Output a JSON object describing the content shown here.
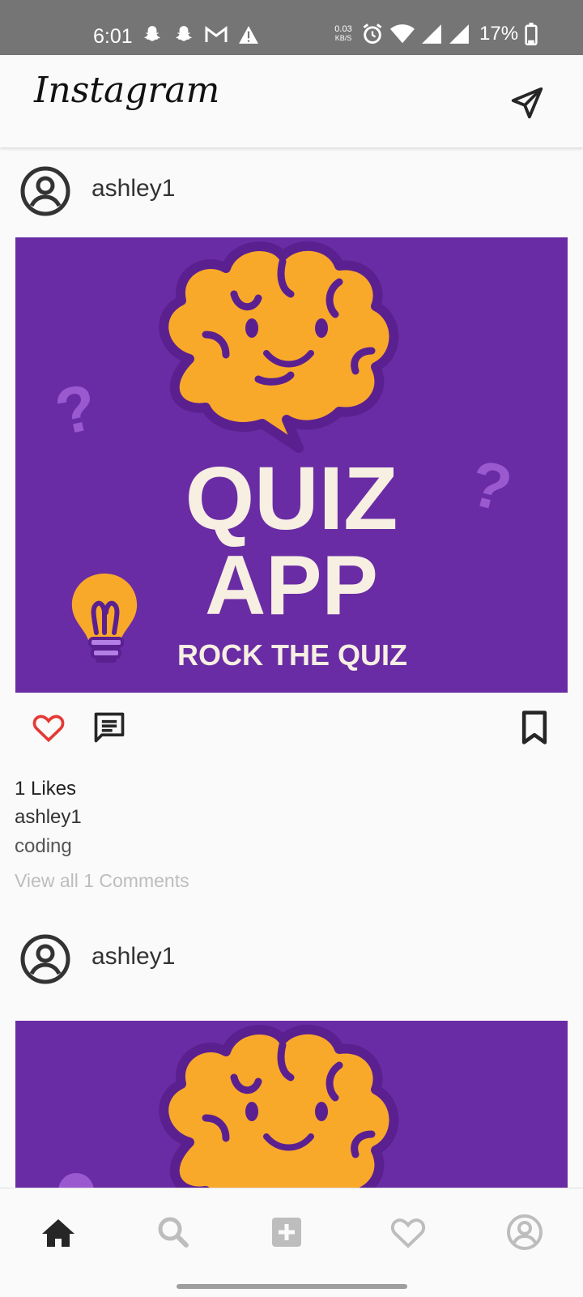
{
  "status_bar": {
    "time": "6:01",
    "net_speed_value": "0.03",
    "net_speed_unit": "KB/S",
    "battery": "17%",
    "icons": [
      "snapchat-icon",
      "snapchat-icon",
      "gmail-icon",
      "warning-icon",
      "alarm-icon",
      "wifi-icon",
      "signal-icon",
      "signal-icon",
      "battery-icon"
    ]
  },
  "header": {
    "logo": "Instagram",
    "send_icon": "send-icon"
  },
  "posts": [
    {
      "username": "ashley1",
      "image": {
        "title_line1": "QUIZ",
        "title_line2": "APP",
        "tagline": "ROCK THE QUIZ",
        "qmark": "?"
      },
      "likes": "1 Likes",
      "caption_user": "ashley1",
      "caption": "coding",
      "view_comments": "View all 1 Comments"
    },
    {
      "username": "ashley1"
    }
  ],
  "bottom_nav": [
    "home-icon",
    "search-icon",
    "add-icon",
    "heart-icon",
    "profile-icon"
  ],
  "colors": {
    "purple": "#6a2ca4",
    "brain": "#f9a92a",
    "like_red": "#e53935"
  }
}
